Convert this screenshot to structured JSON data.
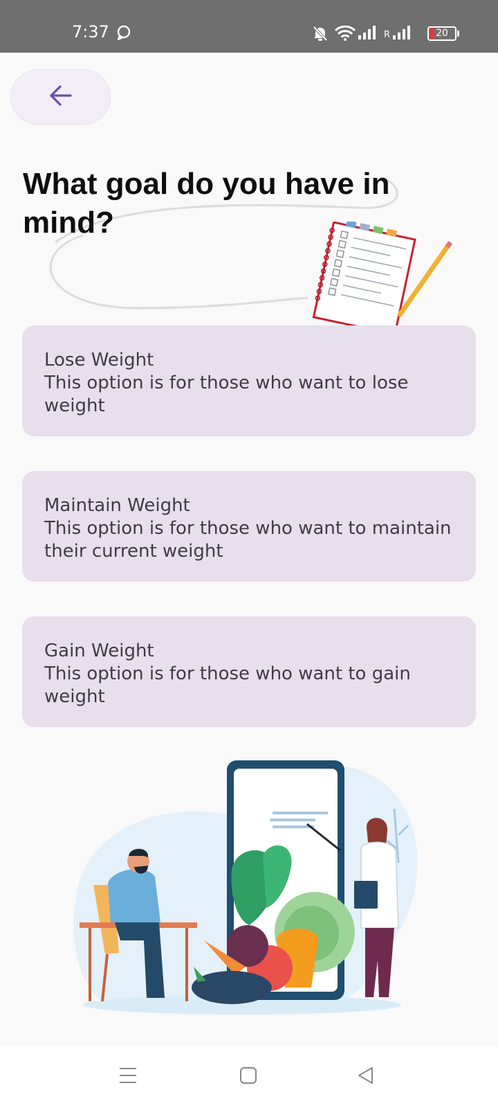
{
  "status_bar": {
    "time": "7:37",
    "battery_level": "20",
    "signal_roaming_label": "R",
    "icons": [
      "chat-bubble-icon",
      "mute-bell-icon",
      "wifi-icon",
      "signal-icon",
      "signal-roaming-icon",
      "battery-icon"
    ]
  },
  "header": {
    "back_icon": "arrow-left-icon",
    "title": "What goal do you have in mind?"
  },
  "options": [
    {
      "title": "Lose Weight",
      "description": "This option is for those who want to lose weight"
    },
    {
      "title": "Maintain Weight",
      "description": "This option is for those who want to maintain their current weight"
    },
    {
      "title": "Gain Weight",
      "description": "This option is for those who want to gain weight"
    }
  ],
  "illustrations": [
    "notebook-checklist-illustration",
    "nutritionist-consultation-illustration"
  ],
  "nav_bar": {
    "icons": [
      "menu-icon",
      "home-square-icon",
      "back-triangle-icon"
    ]
  },
  "colors": {
    "accent": "#6a4fa6",
    "card_background": "#e7dfec",
    "back_button_background": "#f2eef7",
    "status_bar_background": "#6f6f6f"
  }
}
